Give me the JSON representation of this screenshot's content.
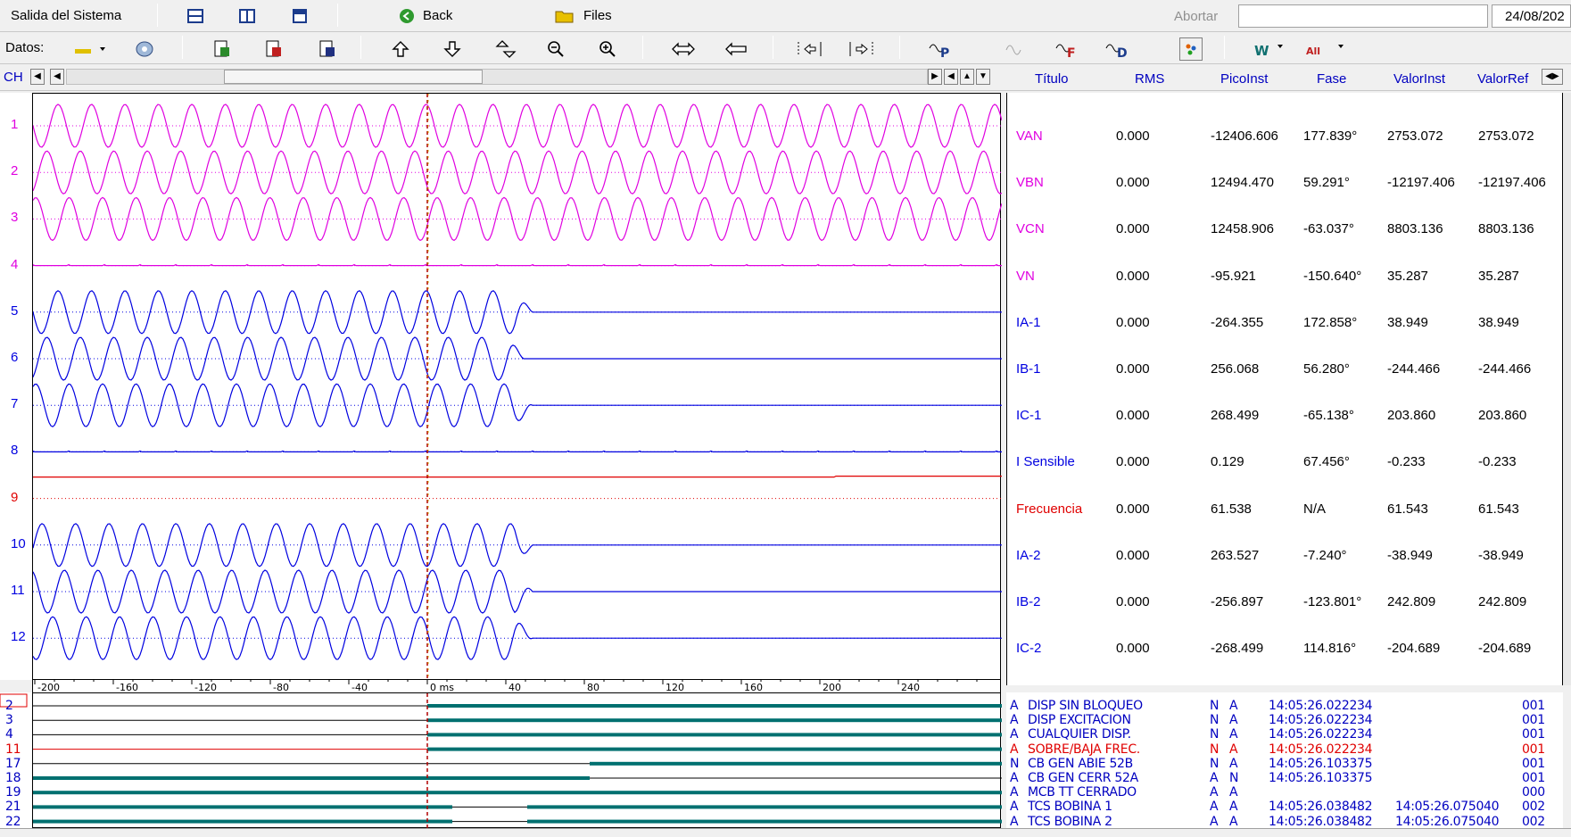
{
  "toolbar1": {
    "system_output": "Salida del Sistema",
    "back": "Back",
    "files": "Files",
    "abort": "Abortar",
    "date": "24/08/202"
  },
  "toolbar2": {
    "datos_label": "Datos:"
  },
  "toolbar3": {
    "ch_label": "CH"
  },
  "table": {
    "headers": [
      "Título",
      "RMS",
      "PicoInst",
      "Fase",
      "ValorInst",
      "ValorRef"
    ],
    "rows": [
      {
        "num": "1",
        "title": "VAN",
        "rms": "0.000",
        "peak": "-12406.606",
        "phase": "177.839°",
        "inst": "2753.072",
        "ref": "2753.072",
        "color": "#e000e0"
      },
      {
        "num": "2",
        "title": "VBN",
        "rms": "0.000",
        "peak": "12494.470",
        "phase": "59.291°",
        "inst": "-12197.406",
        "ref": "-12197.406",
        "color": "#e000e0"
      },
      {
        "num": "3",
        "title": "VCN",
        "rms": "0.000",
        "peak": "12458.906",
        "phase": "-63.037°",
        "inst": "8803.136",
        "ref": "8803.136",
        "color": "#e000e0"
      },
      {
        "num": "4",
        "title": "VN",
        "rms": "0.000",
        "peak": "-95.921",
        "phase": "-150.640°",
        "inst": "35.287",
        "ref": "35.287",
        "color": "#e000e0"
      },
      {
        "num": "5",
        "title": "IA-1",
        "rms": "0.000",
        "peak": "-264.355",
        "phase": "172.858°",
        "inst": "38.949",
        "ref": "38.949",
        "color": "#0000e0"
      },
      {
        "num": "6",
        "title": "IB-1",
        "rms": "0.000",
        "peak": "256.068",
        "phase": "56.280°",
        "inst": "-244.466",
        "ref": "-244.466",
        "color": "#0000e0"
      },
      {
        "num": "7",
        "title": "IC-1",
        "rms": "0.000",
        "peak": "268.499",
        "phase": "-65.138°",
        "inst": "203.860",
        "ref": "203.860",
        "color": "#0000e0"
      },
      {
        "num": "8",
        "title": "I Sensible",
        "rms": "0.000",
        "peak": "0.129",
        "phase": "67.456°",
        "inst": "-0.233",
        "ref": "-0.233",
        "color": "#0000e0"
      },
      {
        "num": "9",
        "title": "Frecuencia",
        "rms": "0.000",
        "peak": "61.538",
        "phase": "N/A",
        "inst": "61.543",
        "ref": "61.543",
        "color": "#e00000"
      },
      {
        "num": "10",
        "title": "IA-2",
        "rms": "0.000",
        "peak": "263.527",
        "phase": "-7.240°",
        "inst": "-38.949",
        "ref": "-38.949",
        "color": "#0000e0"
      },
      {
        "num": "11",
        "title": "IB-2",
        "rms": "0.000",
        "peak": "-256.897",
        "phase": "-123.801°",
        "inst": "242.809",
        "ref": "242.809",
        "color": "#0000e0"
      },
      {
        "num": "12",
        "title": "IC-2",
        "rms": "0.000",
        "peak": "-268.499",
        "phase": "114.816°",
        "inst": "-204.689",
        "ref": "-204.689",
        "color": "#0000e0"
      }
    ]
  },
  "time_axis": {
    "ticks": [
      "-200",
      "-160",
      "-120",
      "-80",
      "-40",
      "0 ms",
      "40",
      "80",
      "120",
      "160",
      "200",
      "240"
    ]
  },
  "digital": [
    {
      "num": "2",
      "flag": "A",
      "name": "DISP SIN BLOQUEO",
      "s1": "N",
      "s2": "A",
      "t1": "14:05:26.022234",
      "t2": "",
      "count": "001",
      "color": "#0000c0"
    },
    {
      "num": "3",
      "flag": "A",
      "name": "DISP EXCITACION",
      "s1": "N",
      "s2": "A",
      "t1": "14:05:26.022234",
      "t2": "",
      "count": "001",
      "color": "#0000c0"
    },
    {
      "num": "4",
      "flag": "A",
      "name": "CUALQUIER DISP.",
      "s1": "N",
      "s2": "A",
      "t1": "14:05:26.022234",
      "t2": "",
      "count": "001",
      "color": "#0000c0"
    },
    {
      "num": "11",
      "flag": "A",
      "name": "SOBRE/BAJA FREC.",
      "s1": "N",
      "s2": "A",
      "t1": "14:05:26.022234",
      "t2": "",
      "count": "001",
      "color": "#e00000"
    },
    {
      "num": "17",
      "flag": "N",
      "name": "CB GEN ABIE 52B",
      "s1": "N",
      "s2": "A",
      "t1": "14:05:26.103375",
      "t2": "",
      "count": "001",
      "color": "#0000c0"
    },
    {
      "num": "18",
      "flag": "A",
      "name": "CB GEN CERR 52A",
      "s1": "A",
      "s2": "N",
      "t1": "14:05:26.103375",
      "t2": "",
      "count": "001",
      "color": "#0000c0"
    },
    {
      "num": "19",
      "flag": "A",
      "name": "MCB TT CERRADO",
      "s1": "A",
      "s2": "A",
      "t1": "",
      "t2": "",
      "count": "000",
      "color": "#0000c0"
    },
    {
      "num": "21",
      "flag": "A",
      "name": "TCS BOBINA 1",
      "s1": "A",
      "s2": "A",
      "t1": "14:05:26.038482",
      "t2": "14:05:26.075040",
      "count": "002",
      "color": "#0000c0"
    },
    {
      "num": "22",
      "flag": "A",
      "name": "TCS BOBINA 2",
      "s1": "A",
      "s2": "A",
      "t1": "14:05:26.038482",
      "t2": "14:05:26.075040",
      "count": "002",
      "color": "#0000c0"
    }
  ],
  "colors": {
    "voltage": "#e000e0",
    "current": "#0000e0",
    "freq": "#e00000",
    "digital_on": "#007070"
  }
}
